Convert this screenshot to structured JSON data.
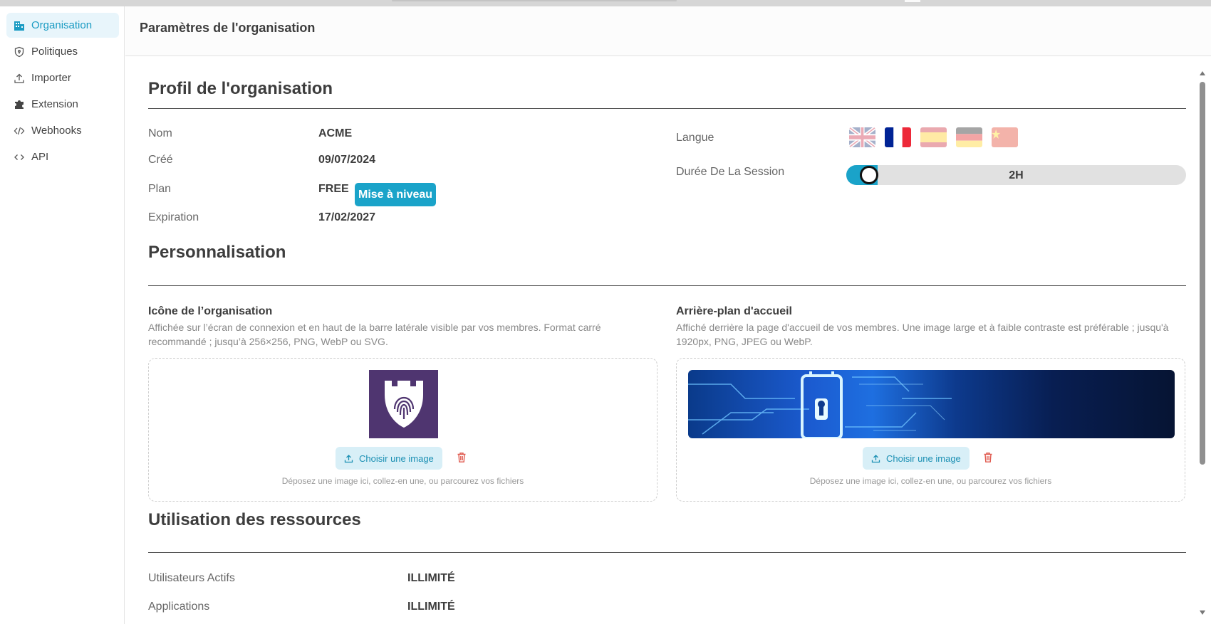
{
  "header": {
    "title": "Paramètres de l'organisation"
  },
  "sidebar": {
    "items": [
      {
        "label": "Organisation",
        "icon": "building-icon",
        "active": true
      },
      {
        "label": "Politiques",
        "icon": "shield-icon"
      },
      {
        "label": "Importer",
        "icon": "upload-icon"
      },
      {
        "label": "Extension",
        "icon": "puzzle-icon"
      },
      {
        "label": "Webhooks",
        "icon": "code-icon"
      },
      {
        "label": "API",
        "icon": "api-icon"
      }
    ]
  },
  "profile": {
    "title": "Profil de l'organisation",
    "name_label": "Nom",
    "name_value": "ACME",
    "created_label": "Créé",
    "created_value": "09/07/2024",
    "plan_label": "Plan",
    "plan_value": "FREE",
    "upgrade_label": "Mise à niveau",
    "expiration_label": "Expiration",
    "expiration_value": "17/02/2027",
    "language_label": "Langue",
    "languages": [
      {
        "code": "en",
        "selected": false
      },
      {
        "code": "fr",
        "selected": true
      },
      {
        "code": "es",
        "selected": false
      },
      {
        "code": "de",
        "selected": false
      },
      {
        "code": "zh",
        "selected": false
      }
    ],
    "session_label": "Durée De La Session",
    "session_value": "2H"
  },
  "customization": {
    "title": "Personnalisation",
    "icon_title": "Icône de l’organisation",
    "icon_desc": "Affichée sur l’écran de connexion et en haut de la barre latérale visible par vos membres. Format carré recommandé ; jusqu’à 256×256, PNG, WebP ou SVG.",
    "bg_title": "Arrière-plan d'accueil",
    "bg_desc": "Affiché derrière la page d'accueil de vos membres. Une image large et à faible contraste est préférable ; jusqu'à 1920px, PNG, JPEG ou WebP.",
    "choose_label": "Choisir une image",
    "drop_hint": "Déposez une image ici, collez-en une, ou parcourez vos fichiers"
  },
  "resources": {
    "title": "Utilisation des ressources",
    "rows": [
      {
        "label": "Utilisateurs Actifs",
        "value": "ILLIMITÉ"
      },
      {
        "label": "Applications",
        "value": "ILLIMITÉ"
      }
    ]
  },
  "colors": {
    "accent": "#1aa3c9",
    "active_bg": "#e8f5fb",
    "danger": "#e05a4f"
  }
}
